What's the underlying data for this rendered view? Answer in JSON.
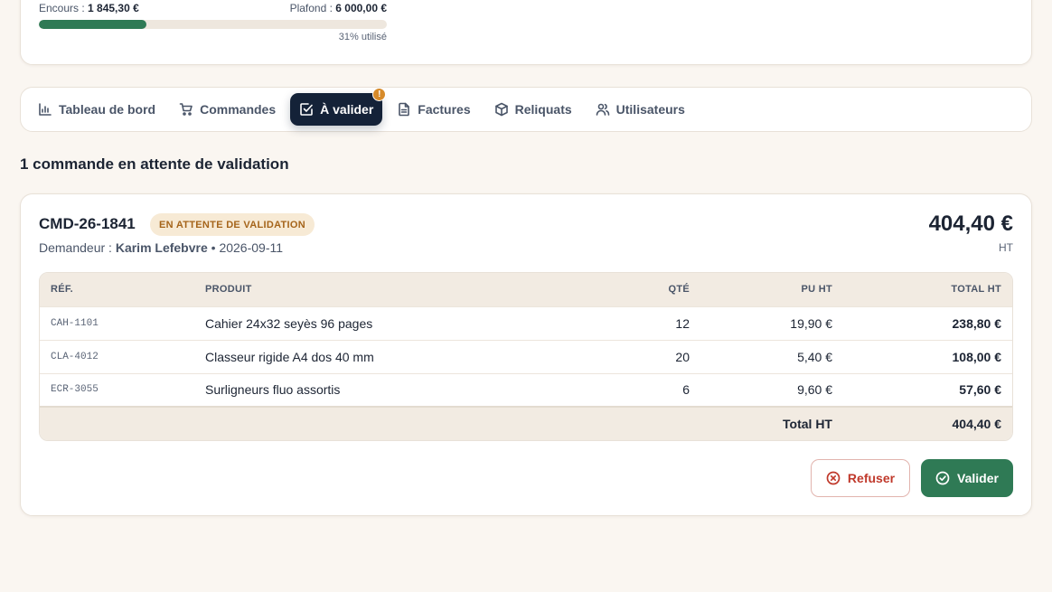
{
  "budget": {
    "encours_label": "Encours : ",
    "encours_value": "1 845,30 €",
    "plafond_label": "Plafond : ",
    "plafond_value": "6 000,00 €",
    "used_percent": 31,
    "used_label": "31% utilisé"
  },
  "nav": {
    "tabs": [
      {
        "label": "Tableau de bord",
        "icon": "bar-chart-icon",
        "active": false
      },
      {
        "label": "Commandes",
        "icon": "cart-icon",
        "active": false
      },
      {
        "label": "À valider",
        "icon": "check-square-icon",
        "active": true,
        "badge": "!"
      },
      {
        "label": "Factures",
        "icon": "document-icon",
        "active": false
      },
      {
        "label": "Reliquats",
        "icon": "box-icon",
        "active": false
      },
      {
        "label": "Utilisateurs",
        "icon": "users-icon",
        "active": false
      }
    ]
  },
  "pending": {
    "title": "1 commande en attente de validation"
  },
  "order": {
    "id": "CMD-26-1841",
    "status": "EN ATTENTE DE VALIDATION",
    "requester_label": "Demandeur : ",
    "requester_name": "Karim Lefebvre",
    "separator": " • ",
    "date": "2026-09-11",
    "total": "404,40 €",
    "total_unit": "HT",
    "table": {
      "headers": [
        "RÉF.",
        "PRODUIT",
        "QTÉ",
        "PU HT",
        "TOTAL HT"
      ],
      "rows": [
        {
          "ref": "CAH-1101",
          "product": "Cahier 24x32 seyès 96 pages",
          "qty": "12",
          "pu": "19,90 €",
          "total": "238,80 €"
        },
        {
          "ref": "CLA-4012",
          "product": "Classeur rigide A4 dos 40 mm",
          "qty": "20",
          "pu": "5,40 €",
          "total": "108,00 €"
        },
        {
          "ref": "ECR-3055",
          "product": "Surligneurs fluo assortis",
          "qty": "6",
          "pu": "9,60 €",
          "total": "57,60 €"
        }
      ],
      "footer_label": "Total HT",
      "footer_value": "404,40 €"
    },
    "actions": {
      "refuse_label": "Refuser",
      "validate_label": "Valider"
    }
  },
  "colors": {
    "accent_dark": "#142238",
    "success": "#2f7a55",
    "danger": "#c0392b",
    "warning": "#d68a2a"
  }
}
